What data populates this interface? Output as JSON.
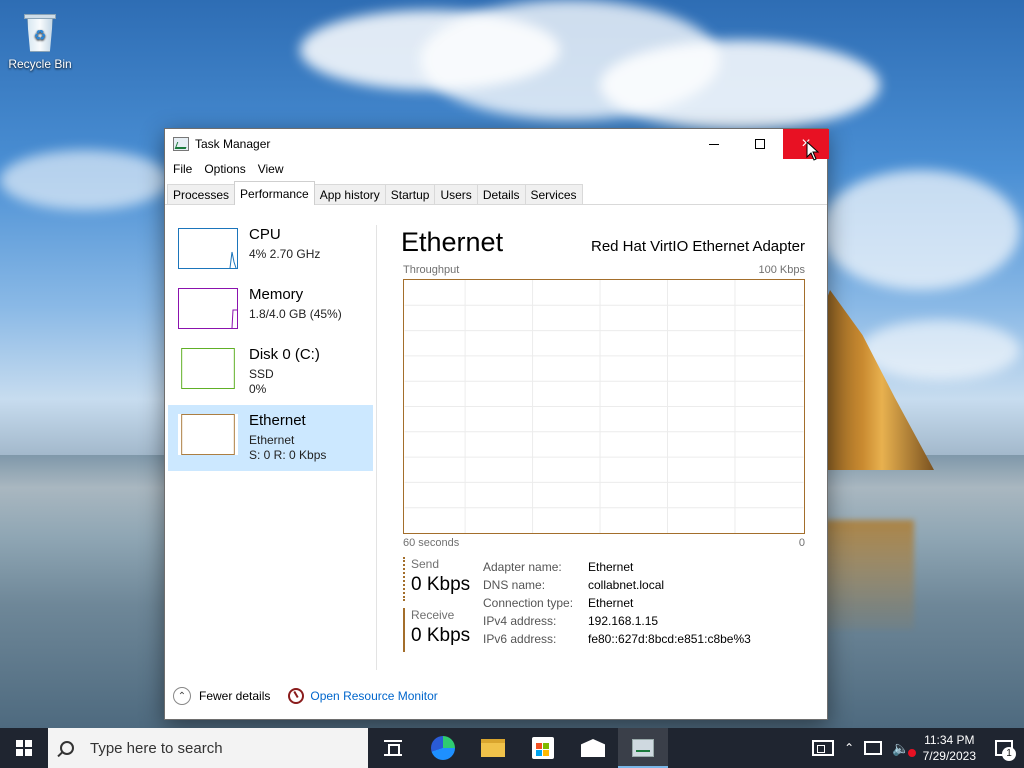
{
  "desktop": {
    "icons": [
      {
        "label": "Recycle Bin",
        "icon": "recycle-bin-icon"
      }
    ]
  },
  "window": {
    "title": "Task Manager",
    "controls": {
      "minimize": "minimize-icon",
      "maximize": "maximize-icon",
      "close": "×"
    },
    "menu": [
      "File",
      "Options",
      "View"
    ],
    "tabs": [
      "Processes",
      "Performance",
      "App history",
      "Startup",
      "Users",
      "Details",
      "Services"
    ],
    "active_tab": "Performance"
  },
  "performance": {
    "resources": [
      {
        "name": "CPU",
        "line1": "4% 2.70 GHz",
        "line2": "",
        "color": "#1b75bb"
      },
      {
        "name": "Memory",
        "line1": "1.8/4.0 GB (45%)",
        "line2": "",
        "color": "#8b12ae"
      },
      {
        "name": "Disk 0 (C:)",
        "line1": "SSD",
        "line2": "0%",
        "color": "#4da60c"
      },
      {
        "name": "Ethernet",
        "line1": "Ethernet",
        "line2": "S: 0 R: 0 Kbps",
        "color": "#a36e2b"
      }
    ],
    "selected_resource": "Ethernet",
    "detail": {
      "title": "Ethernet",
      "adapter": "Red Hat VirtIO Ethernet Adapter",
      "graph": {
        "label_top_left": "Throughput",
        "label_top_right": "100 Kbps",
        "label_bottom_left": "60 seconds",
        "label_bottom_right": "0"
      },
      "send": {
        "label": "Send",
        "value": "0 Kbps"
      },
      "receive": {
        "label": "Receive",
        "value": "0 Kbps"
      },
      "properties": [
        {
          "key": "Adapter name:",
          "value": "Ethernet"
        },
        {
          "key": "DNS name:",
          "value": "collabnet.local"
        },
        {
          "key": "Connection type:",
          "value": "Ethernet"
        },
        {
          "key": "IPv4 address:",
          "value": "192.168.1.15"
        },
        {
          "key": "IPv6 address:",
          "value": "fe80::627d:8bcd:e851:c8be%3"
        }
      ]
    },
    "footer": {
      "fewer_details": "Fewer details",
      "open_resource_monitor": "Open Resource Monitor"
    }
  },
  "taskbar": {
    "search_placeholder": "Type here to search",
    "apps": [
      "task-view-icon",
      "edge-icon",
      "file-explorer-icon",
      "store-icon",
      "mail-icon",
      "task-manager-icon"
    ],
    "clock": {
      "time": "11:34 PM",
      "date": "7/29/2023"
    },
    "notification_count": "1"
  }
}
